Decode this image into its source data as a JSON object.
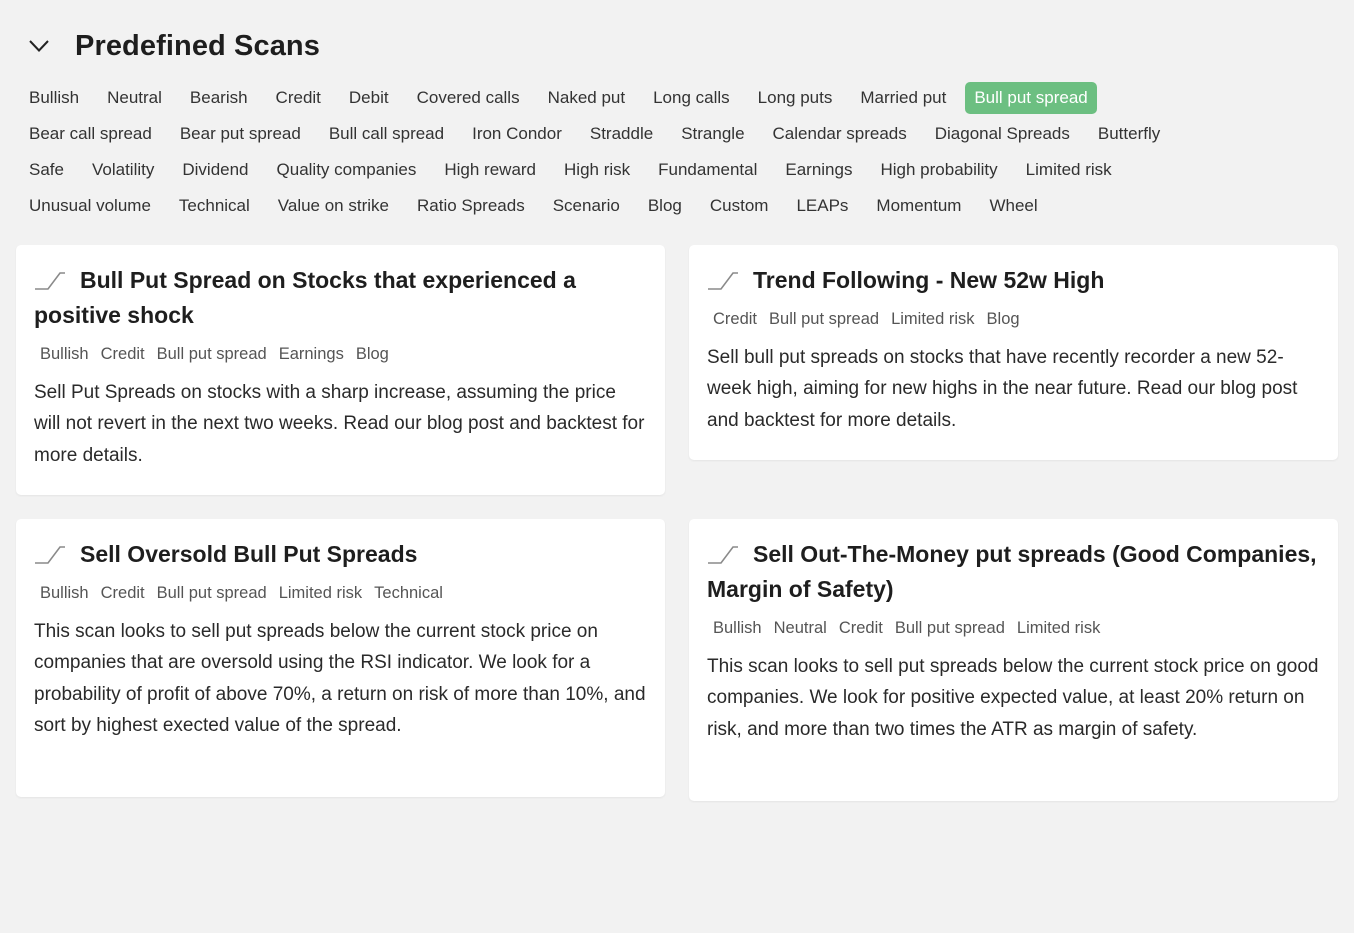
{
  "header": {
    "title": "Predefined Scans"
  },
  "filters": {
    "rows": [
      [
        "Bullish",
        "Neutral",
        "Bearish",
        "Credit",
        "Debit",
        "Covered calls",
        "Naked put",
        "Long calls",
        "Long puts",
        "Married put",
        "Bull put spread"
      ],
      [
        "Bear call spread",
        "Bear put spread",
        "Bull call spread",
        "Iron Condor",
        "Straddle",
        "Strangle",
        "Calendar spreads",
        "Diagonal Spreads",
        "Butterfly"
      ],
      [
        "Safe",
        "Volatility",
        "Dividend",
        "Quality companies",
        "High reward",
        "High risk",
        "Fundamental",
        "Earnings",
        "High probability",
        "Limited risk"
      ],
      [
        "Unusual volume",
        "Technical",
        "Value on strike",
        "Ratio Spreads",
        "Scenario",
        "Blog",
        "Custom",
        "LEAPs",
        "Momentum",
        "Wheel"
      ]
    ],
    "active": "Bull put spread"
  },
  "colors": {
    "active_chip": "#6cbf81",
    "background": "#f2f2f2",
    "card": "#ffffff"
  },
  "cards": [
    {
      "title": "Bull Put Spread on Stocks that experienced a positive shock",
      "icon": "bull-put-spread-payoff-icon",
      "tags": [
        "Bullish",
        "Credit",
        "Bull put spread",
        "Earnings",
        "Blog"
      ],
      "description": "Sell Put Spreads on stocks with a sharp increase, assuming the price will not revert in the next two weeks. Read our blog post and backtest for more details."
    },
    {
      "title": "Trend Following - New 52w High",
      "icon": "bull-put-spread-payoff-icon",
      "tags": [
        "Credit",
        "Bull put spread",
        "Limited risk",
        "Blog"
      ],
      "description": "Sell bull put spreads on stocks that have recently recorder a new 52-week high, aiming for new highs in the near future. Read our blog post and backtest for more details."
    },
    {
      "title": "Sell Oversold Bull Put Spreads",
      "icon": "bull-put-spread-payoff-icon",
      "tags": [
        "Bullish",
        "Credit",
        "Bull put spread",
        "Limited risk",
        "Technical"
      ],
      "description": "This scan looks to sell put spreads below the current stock price on companies that are oversold using the RSI indicator. We look for a probability of profit of above 70%, a return on risk of more than 10%, and sort by highest exected value of the spread."
    },
    {
      "title": "Sell Out-The-Money put spreads (Good Companies, Margin of Safety)",
      "icon": "bull-put-spread-payoff-icon",
      "tags": [
        "Bullish",
        "Neutral",
        "Credit",
        "Bull put spread",
        "Limited risk"
      ],
      "description": "This scan looks to sell put spreads below the current stock price on good companies. We look for positive expected value, at least 20% return on risk, and more than two times the ATR as margin of safety."
    }
  ]
}
